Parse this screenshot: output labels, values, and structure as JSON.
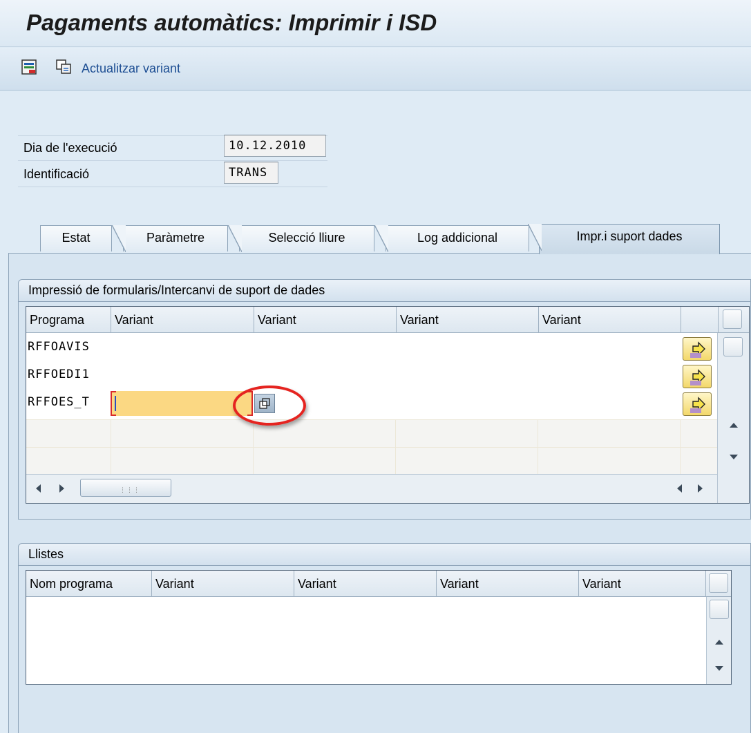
{
  "window": {
    "title": "Pagaments automàtics: Imprimir i ISD"
  },
  "toolbar": {
    "save_icon": "save-variant-icon",
    "copy_icon": "copy-icon",
    "update_variant_label": "Actualitzar variant"
  },
  "header_fields": {
    "run_date_label": "Dia de l'execució",
    "run_date_value": "10.12.2010",
    "identification_label": "Identificació",
    "identification_value": "TRANS"
  },
  "tabs": [
    {
      "label": "Estat",
      "active": false
    },
    {
      "label": "Paràmetre",
      "active": false
    },
    {
      "label": "Selecció lliure",
      "active": false
    },
    {
      "label": "Log addicional",
      "active": false
    },
    {
      "label": "Impr.i suport dades",
      "active": true
    }
  ],
  "forms_group": {
    "title": "Impressió de formularis/Intercanvi de suport de dades",
    "columns": [
      "Programa",
      "Variant",
      "Variant",
      "Variant",
      "Variant"
    ],
    "rows": [
      {
        "program": "RFFOAVIS",
        "variant": ""
      },
      {
        "program": "RFFOEDI1",
        "variant": ""
      },
      {
        "program": "RFFOES_T",
        "variant": ""
      }
    ]
  },
  "lists_group": {
    "title": "Llistes",
    "columns": [
      "Nom programa",
      "Variant",
      "Variant",
      "Variant",
      "Variant"
    ]
  },
  "colors": {
    "accent": "#1d4e93",
    "panel": "#d7e5f1",
    "input_edit": "#fbd883",
    "highlight": "#e52420"
  }
}
